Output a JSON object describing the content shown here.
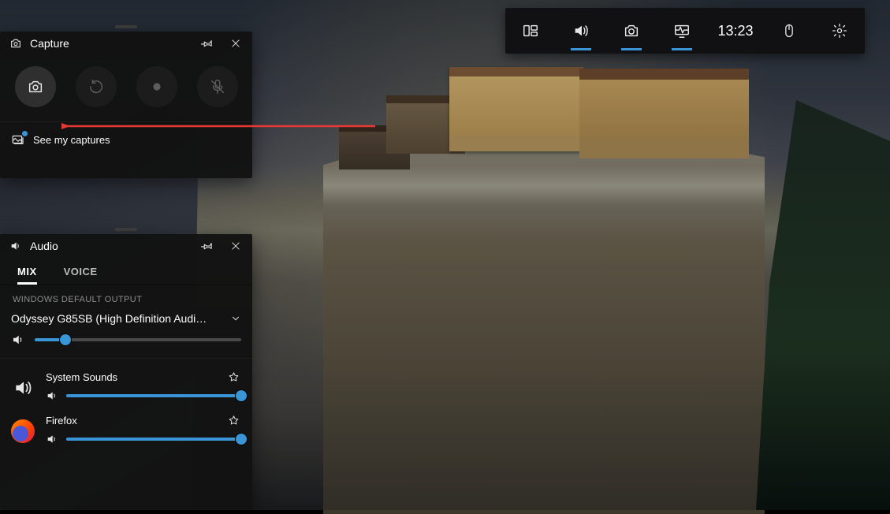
{
  "topbar": {
    "time": "13:23"
  },
  "capture": {
    "title": "Capture",
    "see_my_captures": "See my captures"
  },
  "audio": {
    "title": "Audio",
    "tabs": {
      "mix": "MIX",
      "voice": "VOICE"
    },
    "default_out_label": "WINDOWS DEFAULT OUTPUT",
    "device": "Odyssey G85SB (High Definition Audio D...",
    "master_volume_pct": 15,
    "apps": [
      {
        "name": "System Sounds",
        "volume_pct": 100
      },
      {
        "name": "Firefox",
        "volume_pct": 100
      }
    ]
  }
}
